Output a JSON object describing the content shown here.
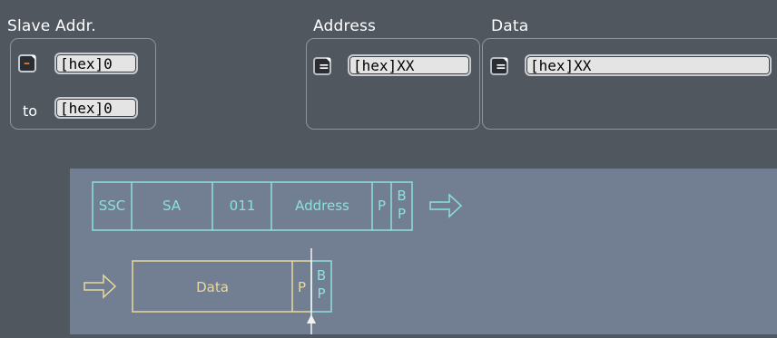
{
  "slave_addr": {
    "label": "Slave Addr.",
    "min": {
      "operator": "–",
      "value": "[hex]0"
    },
    "to_label": "to",
    "max": {
      "value": "[hex]0"
    }
  },
  "address": {
    "label": "Address",
    "operator": "=",
    "value": "[hex]XX"
  },
  "data": {
    "label": "Data",
    "operator": "=",
    "value": "[hex]XX"
  },
  "diagram": {
    "row1": [
      "SSC",
      "SA",
      "011",
      "Address",
      "P",
      "B",
      "P"
    ],
    "row2": [
      "Data",
      "P",
      "B",
      "P"
    ]
  },
  "colors": {
    "cyan": "#8de0d8",
    "yellow": "#e9d99a",
    "diagram_bg": "#727f93",
    "panel_bg": "#50575f"
  }
}
